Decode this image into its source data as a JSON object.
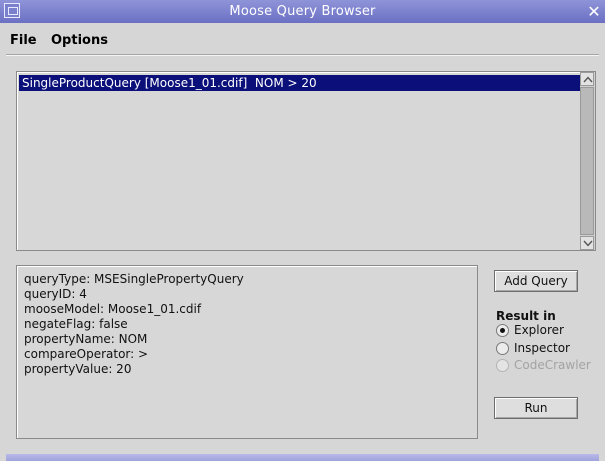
{
  "window": {
    "title": "Moose Query Browser"
  },
  "menu": {
    "file": "File",
    "options": "Options"
  },
  "query_list": {
    "items": [
      {
        "label": "SingleProductQuery [Moose1_01.cdif]  NOM > 20",
        "selected": true
      }
    ]
  },
  "details": {
    "lines": [
      "queryType: MSESinglePropertyQuery",
      "queryID: 4",
      "mooseModel: Moose1_01.cdif",
      "negateFlag: false",
      "propertyName: NOM",
      "compareOperator: >",
      "propertyValue: 20"
    ]
  },
  "buttons": {
    "add_query": "Add Query",
    "run": "Run"
  },
  "result_in": {
    "label": "Result in",
    "options": [
      {
        "label": "Explorer",
        "checked": true,
        "enabled": true
      },
      {
        "label": "Inspector",
        "checked": false,
        "enabled": true
      },
      {
        "label": "CodeCrawler",
        "checked": false,
        "enabled": false
      }
    ]
  },
  "colors": {
    "title_bar": "#6b70c4",
    "selection": "#0a0f7a",
    "background": "#d6d6d6"
  }
}
